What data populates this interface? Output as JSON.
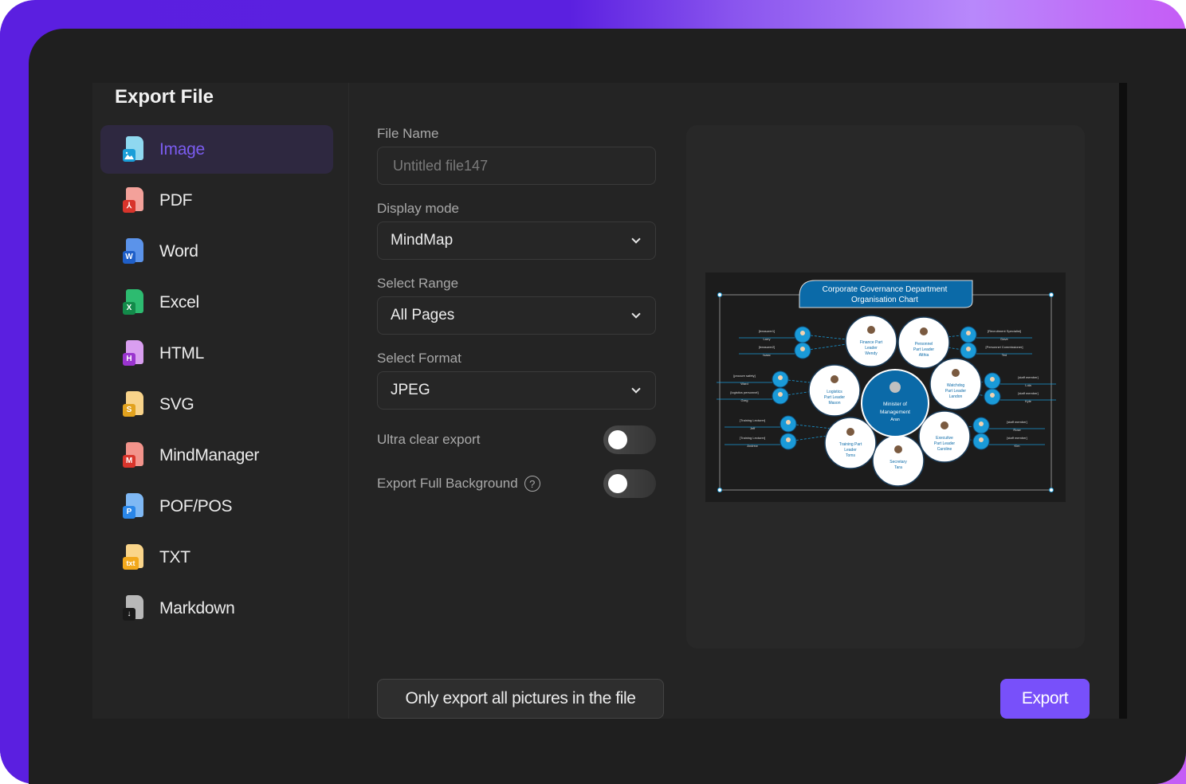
{
  "dialog": {
    "title": "Export File"
  },
  "sidebar": {
    "items": [
      {
        "label": "Image",
        "icon": "image-file-icon",
        "badge": "",
        "page_color": "#8fd8f0",
        "badge_color": "#1a9ed8",
        "active": true
      },
      {
        "label": "PDF",
        "icon": "pdf-file-icon",
        "badge": "⅄",
        "page_color": "#f3a19a",
        "badge_color": "#d8342b",
        "active": false
      },
      {
        "label": "Word",
        "icon": "word-file-icon",
        "badge": "W",
        "page_color": "#5b93ea",
        "badge_color": "#1f5fc8",
        "active": false
      },
      {
        "label": "Excel",
        "icon": "excel-file-icon",
        "badge": "X",
        "page_color": "#2dbb70",
        "badge_color": "#138a4a",
        "active": false
      },
      {
        "label": "HTML",
        "icon": "html-file-icon",
        "badge": "H",
        "page_color": "#d99ef0",
        "badge_color": "#9a34cf",
        "active": false
      },
      {
        "label": "SVG",
        "icon": "svg-file-icon",
        "badge": "S",
        "page_color": "#f8d38a",
        "badge_color": "#e2a21e",
        "active": false
      },
      {
        "label": "MindManager",
        "icon": "mindmanager-file-icon",
        "badge": "M",
        "page_color": "#f2938b",
        "badge_color": "#d8352c",
        "active": false
      },
      {
        "label": "POF/POS",
        "icon": "pof-file-icon",
        "badge": "P",
        "page_color": "#7fb8f4",
        "badge_color": "#2a86e8",
        "active": false
      },
      {
        "label": "TXT",
        "icon": "txt-file-icon",
        "badge": "txt",
        "page_color": "#fad58a",
        "badge_color": "#f2a81c",
        "active": false
      },
      {
        "label": "Markdown",
        "icon": "markdown-file-icon",
        "badge": "↓",
        "page_color": "#b8b8b8",
        "badge_color": "#1a1a1a",
        "active": false
      }
    ]
  },
  "form": {
    "file_name": {
      "label": "File Name",
      "value": "",
      "placeholder": "Untitled file147"
    },
    "display_mode": {
      "label": "Display mode",
      "value": "MindMap"
    },
    "select_range": {
      "label": "Select Range",
      "value": "All Pages"
    },
    "select_format": {
      "label": "Select Format",
      "value": "JPEG"
    },
    "ultra_clear": {
      "label": "Ultra clear export",
      "on": false
    },
    "full_background": {
      "label": "Export Full Background",
      "help": "?",
      "on": false
    }
  },
  "preview": {
    "title_line1": "Corporate Governance Department",
    "title_line2": "Organisation Chart",
    "center": {
      "l1": "Minister of",
      "l2": "Management",
      "l3": "Aran"
    },
    "nodes": [
      {
        "l1": "Finance Part",
        "l2": "Leader",
        "l3": "Wendy"
      },
      {
        "l1": "Personnel",
        "l2": "Part Leader",
        "l3": "Althia"
      },
      {
        "l1": "Watchdog",
        "l2": "Part Leader",
        "l3": "Landon"
      },
      {
        "l1": "Executive",
        "l2": "Part Leader",
        "l3": "Caroline"
      },
      {
        "l1": "Secretary",
        "l2": "Tara",
        "l3": ""
      },
      {
        "l1": "Training Part",
        "l2": "Leader",
        "l3": "Toms"
      },
      {
        "l1": "Logistics",
        "l2": "Part Leader",
        "l3": "Mason"
      }
    ],
    "staff_left": [
      {
        "role": "[treasurer1]",
        "name": "Larry"
      },
      {
        "role": "[treasurer2]",
        "name": "Isaac"
      },
      {
        "role": "[procure safety]",
        "name": "Ward"
      },
      {
        "role": "[logistics personnel]",
        "name": "Greg"
      },
      {
        "role": "[Training Lecturer]",
        "name": "Jeff"
      },
      {
        "role": "[Training Lecturer]",
        "name": "Andrew"
      }
    ],
    "staff_right": [
      {
        "role": "[Recruitment Specialist]",
        "name": "Dave"
      },
      {
        "role": "[Personnel Commissioner]",
        "name": "Ted"
      },
      {
        "role": "[staff member]",
        "name": "Lola"
      },
      {
        "role": "[staff member]",
        "name": "Kyle"
      },
      {
        "role": "[staff member]",
        "name": "Rose"
      },
      {
        "role": "[staff member]",
        "name": "Kim"
      }
    ]
  },
  "actions": {
    "pictures_label": "Only export all pictures in the file",
    "export_label": "Export"
  },
  "colors": {
    "accent": "#7850fa",
    "active_text": "#7b5cf0",
    "chart_blue": "#0b6aa8",
    "staff_blue": "#1a9ad8"
  }
}
